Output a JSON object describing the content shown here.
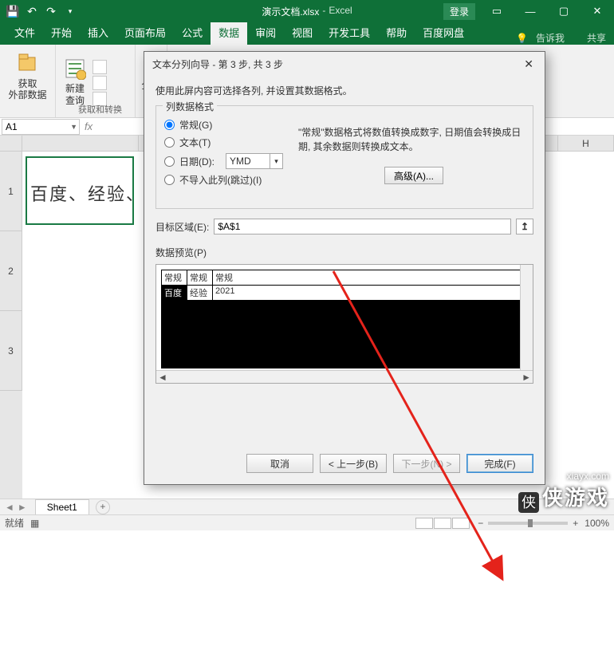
{
  "title": {
    "filename": "演示文档.xlsx",
    "app": "Excel",
    "login": "登录"
  },
  "tabs": {
    "file": "文件",
    "home": "开始",
    "insert": "插入",
    "layout": "页面布局",
    "formula": "公式",
    "data": "数据",
    "review": "审阅",
    "view": "视图",
    "dev": "开发工具",
    "help": "帮助",
    "baidu": "百度网盘",
    "tell": "告诉我",
    "share": "共享"
  },
  "ribbon": {
    "getext": "获取\n外部数据",
    "newq": "新建\n查询",
    "grp1": "获取和转换",
    "all": "全部"
  },
  "namebox": "A1",
  "cellA1": "百度、经验、",
  "colH": "H",
  "rows": [
    "1",
    "2",
    "3"
  ],
  "sheet": "Sheet1",
  "status": {
    "ready": "就绪",
    "zoom": "100%"
  },
  "dialog": {
    "title": "文本分列向导 - 第 3 步, 共 3 步",
    "instr": "使用此屏内容可选择各列, 并设置其数据格式。",
    "fs_legend": "列数据格式",
    "r_general": "常规(G)",
    "r_text": "文本(T)",
    "r_date": "日期(D):",
    "r_skip": "不导入此列(跳过)(I)",
    "date_fmt": "YMD",
    "info": "\"常规\"数据格式将数值转换成数字, 日期值会转换成日期, 其余数据则转换成文本。",
    "adv": "高级(A)...",
    "dest_lbl": "目标区域(E):",
    "dest_val": "$A$1",
    "prev_lbl": "数据预览(P)",
    "pv_h": [
      "常规",
      "常规",
      "常规"
    ],
    "pv_r": [
      "百度",
      "经验",
      "2021"
    ],
    "btn_cancel": "取消",
    "btn_back": "< 上一步(B)",
    "btn_next": "下一步(N) >",
    "btn_finish": "完成(F)"
  },
  "wm": {
    "url": "xiayx.com",
    "brand": "侠游戏"
  }
}
